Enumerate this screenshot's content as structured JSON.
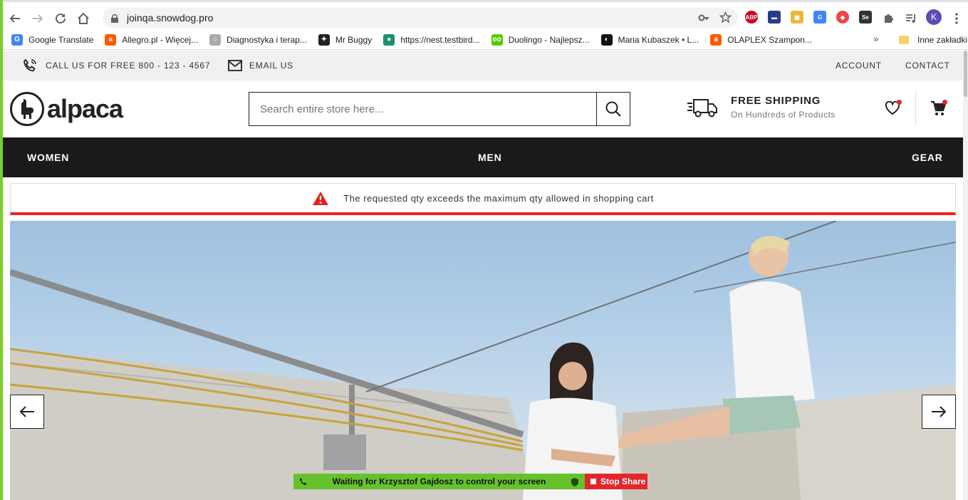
{
  "browser": {
    "url": "joinqa.snowdog.pro",
    "bookmarks": [
      {
        "label": "Google Translate",
        "icon": "google-translate-icon",
        "color": "#4285f4",
        "glyph": "G"
      },
      {
        "label": "Allegro.pl - Więcej...",
        "icon": "allegro-icon",
        "color": "#ff5a00",
        "glyph": "a"
      },
      {
        "label": "Diagnostyka i terap...",
        "icon": "diagnostyka-icon",
        "color": "#aaaaaa",
        "glyph": "○"
      },
      {
        "label": "Mr Buggy",
        "icon": "mr-buggy-icon",
        "color": "#222222",
        "glyph": "✦"
      },
      {
        "label": "https://nest.testbird...",
        "icon": "testbird-icon",
        "color": "#1d8f6e",
        "glyph": "●"
      },
      {
        "label": "Duolingo - Najlepsz...",
        "icon": "duolingo-icon",
        "color": "#58cc02",
        "glyph": "oo"
      },
      {
        "label": "Maria Kubaszek • L...",
        "icon": "maria-icon",
        "color": "#111111",
        "glyph": "◐"
      },
      {
        "label": "OLAPLEX Szampon...",
        "icon": "olaplex-icon",
        "color": "#ff5a00",
        "glyph": "a"
      }
    ],
    "more_bookmarks": "»",
    "other_bookmarks": "Inne zakładki",
    "profile_initial": "K"
  },
  "topbar": {
    "call": "CALL US FOR FREE 800 - 123 - 4567",
    "email": "EMAIL US",
    "account": "ACCOUNT",
    "contact": "CONTACT"
  },
  "header": {
    "logo": "alpaca",
    "search_placeholder": "Search entire store here...",
    "shipping_title": "FREE SHIPPING",
    "shipping_sub": "On Hundreds of Products"
  },
  "nav": {
    "women": "WOMEN",
    "men": "MEN",
    "gear": "GEAR"
  },
  "message": {
    "text": "The requested qty exceeds the maximum qty allowed in shopping cart",
    "color": "#e22222"
  },
  "share": {
    "waiting": "Waiting for Krzysztof Gajdosz to control your screen",
    "stop": "Stop Share"
  }
}
